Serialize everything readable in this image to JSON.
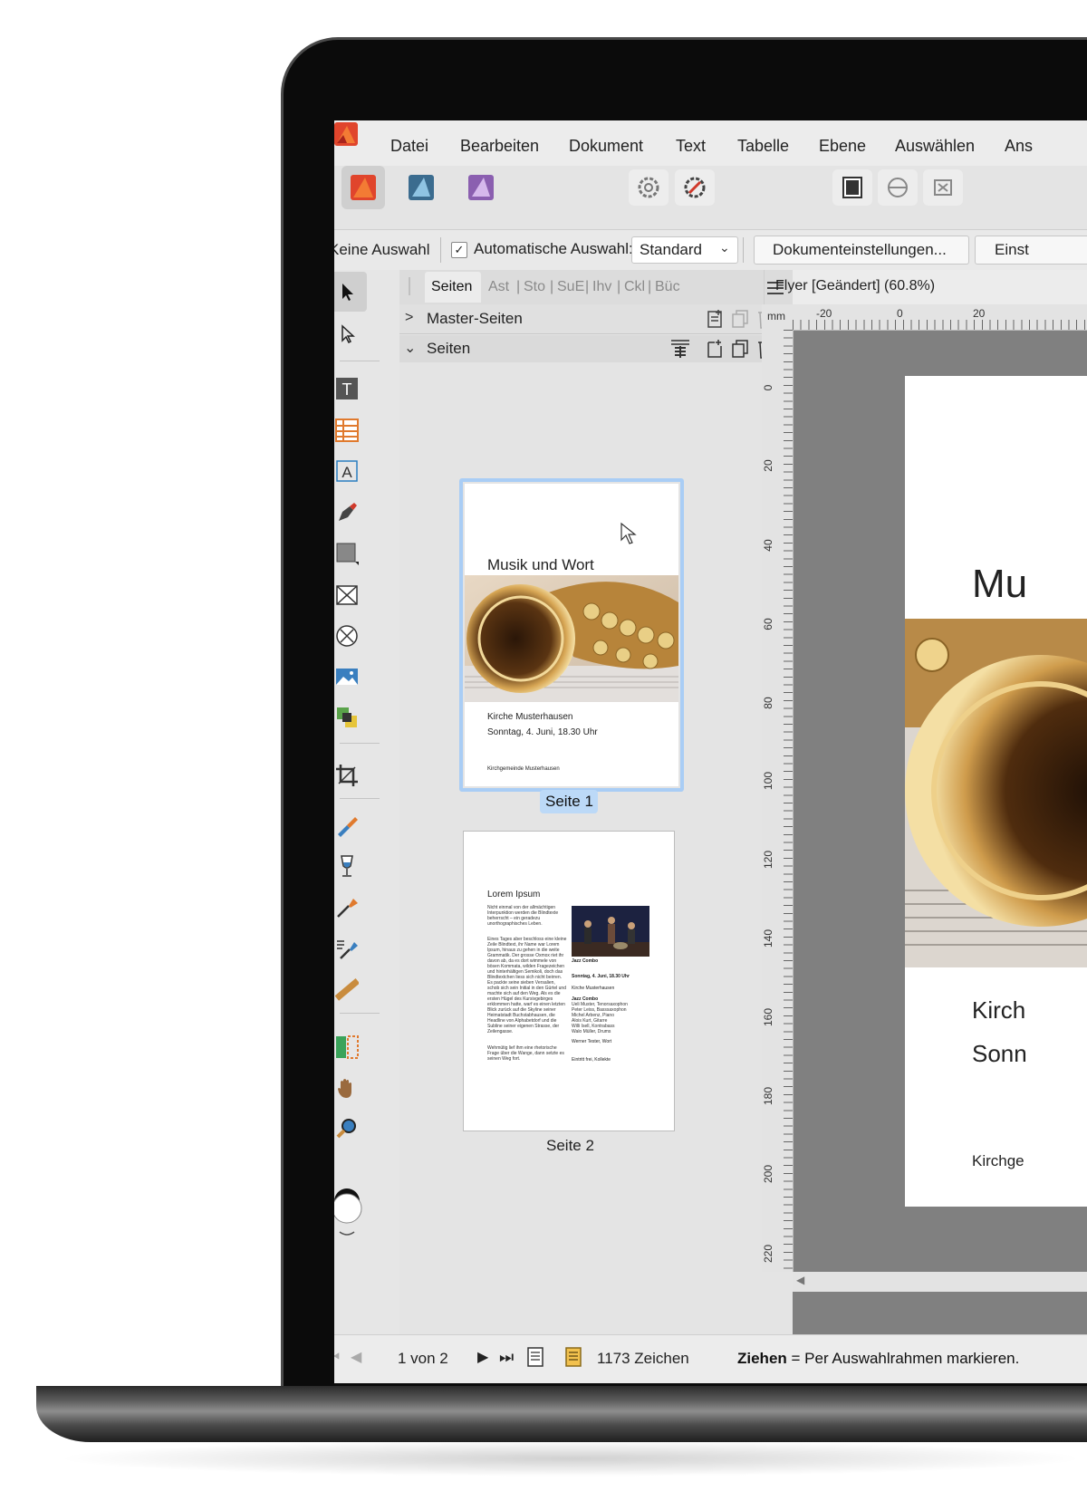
{
  "menu": [
    "Datei",
    "Bearbeiten",
    "Dokument",
    "Text",
    "Tabelle",
    "Ebene",
    "Auswählen",
    "Ans"
  ],
  "context": {
    "selection_status": "Keine Auswahl",
    "auto_select_label": "Automatische Auswahl:",
    "auto_select_value": "Standard",
    "document_settings_button": "Dokumenteinstellungen...",
    "second_button": "Einst"
  },
  "panel": {
    "tabs": [
      "Seiten",
      "Ast",
      "Sto",
      "SuE",
      "Ihv",
      "Ckl",
      "Büc"
    ],
    "master_section": "Master-Seiten",
    "pages_section": "Seiten",
    "page1_label": "Seite 1",
    "page2_label": "Seite 2"
  },
  "page1": {
    "title": "Musik und Wort",
    "line1": "Kirche Musterhausen",
    "line2": "Sonntag, 4. Juni, 18.30 Uhr",
    "footer": "Kirchgemeinde Musterhausen"
  },
  "page2": {
    "title": "Lorem Ipsum",
    "body1": "Nicht einmal von der allmächtigen Interpunktion werden die Blindtexte beherrscht – ein geradezu unorthographisches Leben.",
    "body2": "Eines Tages aber beschloss eine kleine Zeile Blindtext, ihr Name war Lorem Ipsum, hinaus zu gehen in die weite Grammatik. Der grosse Oxmox riet ihr davon ab, da es dort wimmele von bösen Kommata, wilden Fragezeichen und hinterhältigen Semikoli, doch das Blindtextchen liess sich nicht beirren. Es packte seine sieben Versalien, schob sich sein Initial in den Gürtel und machte sich auf den Weg. Als es die ersten Hügel des Kursivgebirges erklommen hatte, warf es einen letzten Blick zurück auf die Skyline seiner Heimatstadt Buchstabhausen, die Headline von Alphabetdorf und die Subline seiner eigenen Strasse, der Zeilengasse.",
    "body3": "Wehmütig lief ihm eine rhetorische Frage über die Wange, dann setzte es seinen Weg fort.",
    "photo_caption": "Jazz Combo",
    "date": "Sonntag, 4. Juni, 18.30 Uhr",
    "place": "Kirche Musterhausen",
    "combo_title": "Jazz Combo",
    "members": [
      "Ueli Muster, Tenorsaxophon",
      "Peter Leiss, Basssaxophon",
      "Michel Arbenz, Piano",
      "Alois Kurt, Gitarre",
      "Willi Isell, Kontrabass",
      "Walo Müller, Drums"
    ],
    "speaker": "Werner Tester, Wort",
    "entry": "Eintritt frei, Kollekte"
  },
  "document": {
    "tab_title": "Flyer [Geändert] (60.8%)",
    "ruler_unit": "mm",
    "h_ruler_labels": [
      "-20",
      "0",
      "20"
    ],
    "v_ruler_labels": [
      "0",
      "20",
      "40",
      "60",
      "80",
      "100",
      "120",
      "140",
      "160",
      "180",
      "200",
      "220"
    ],
    "canvas_title": "Mu",
    "canvas_line1": "Kirch",
    "canvas_line2": "Sonn",
    "canvas_footer": "Kirchge"
  },
  "status": {
    "page_counter": "1 von 2",
    "char_count": "1173 Zeichen",
    "hint_bold": "Ziehen",
    "hint_text": " = Per Auswahlrahmen markieren."
  },
  "colors": {
    "accent": "#4a90e2",
    "selected_thumb_border": "#a9cdf5",
    "canvas_bg": "#808080"
  }
}
